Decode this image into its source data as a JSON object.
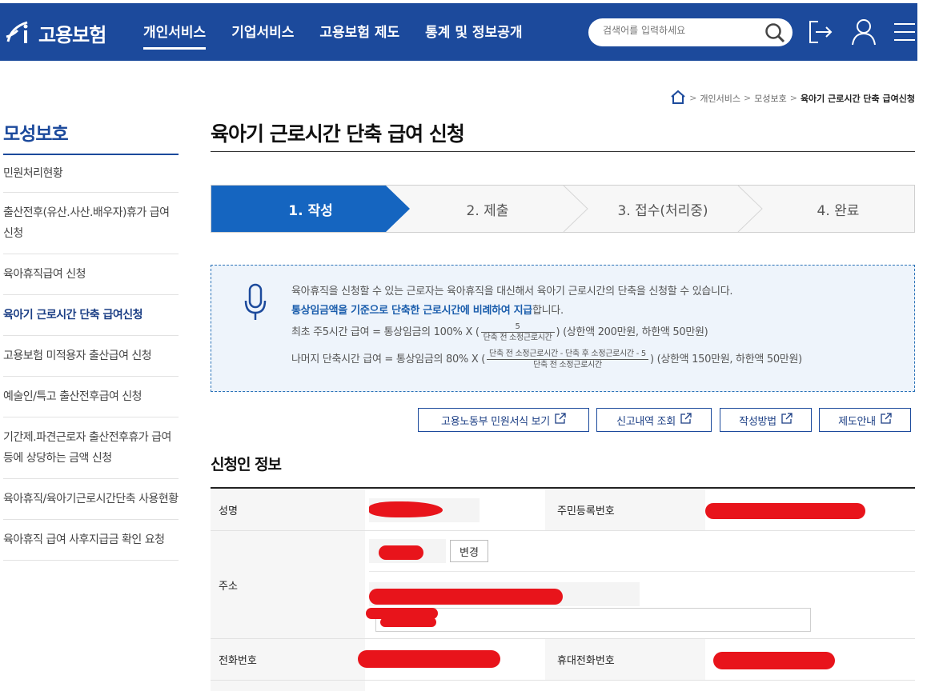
{
  "header": {
    "logo_text": "고용보험",
    "nav": [
      {
        "label": "개인서비스",
        "active": true
      },
      {
        "label": "기업서비스",
        "active": false
      },
      {
        "label": "고용보험 제도",
        "active": false
      },
      {
        "label": "통계 및 정보공개",
        "active": false
      }
    ],
    "search_placeholder": "검색어를 입력하세요",
    "accent": "#1c4a9c"
  },
  "breadcrumb": {
    "items": [
      "개인서비스",
      "모성보호"
    ],
    "current": "육아기 근로시간 단축 급여신청"
  },
  "sidebar": {
    "title": "모성보호",
    "items": [
      {
        "label": "민원처리현황",
        "active": false
      },
      {
        "label": "출산전후(유산.사산.배우자)휴가 급여신청",
        "active": false
      },
      {
        "label": "육아휴직급여 신청",
        "active": false
      },
      {
        "label": "육아기 근로시간 단축 급여신청",
        "active": true
      },
      {
        "label": "고용보험 미적용자 출산급여 신청",
        "active": false
      },
      {
        "label": "예술인/특고 출산전후급여 신청",
        "active": false
      },
      {
        "label": "기간제.파견근로자 출산전후휴가 급여등에 상당하는 금액 신청",
        "active": false
      },
      {
        "label": "육아휴직/육아기근로시간단축 사용현황",
        "active": false
      },
      {
        "label": "육아휴직 급여 사후지급금 확인 요청",
        "active": false
      }
    ]
  },
  "main": {
    "title": "육아기 근로시간 단축 급여 신청",
    "steps": [
      {
        "label": "1. 작성",
        "active": true
      },
      {
        "label": "2. 제출",
        "active": false
      },
      {
        "label": "3. 접수(처리중)",
        "active": false
      },
      {
        "label": "4. 완료",
        "active": false
      }
    ],
    "info": {
      "line1": "육아휴직을 신청할 수 있는 근로자는 육아휴직을 대신해서 육아기 근로시간의 단축을 신청할 수 있습니다.",
      "line2_bold": "통상임금액을 기준으로 단축한 근로시간에 비례하여 지급",
      "line2_rest": "합니다.",
      "line3_prefix": "최초 주5시간 급여 = 통상임금의 100% X (",
      "line3_num": "5",
      "line3_den": "단축 전 소정근로시간",
      "line3_suffix": ") (상한액 200만원, 하한액 50만원)",
      "line4_prefix": "나머지 단축시간 급여 = 통상임금의 80% X (",
      "line4_num": "단축 전 소정근로시간 - 단축 후 소정근로시간 - 5",
      "line4_den": "단축 전 소정근로시간",
      "line4_suffix": ") (상한액 150만원, 하한액 50만원)"
    },
    "buttons": [
      "고용노동부 민원서식 보기",
      "신고내역 조회",
      "작성방법",
      "제도안내"
    ],
    "section_title": "신청인 정보",
    "form": {
      "name_label": "성명",
      "rrn_label": "주민등록번호",
      "address_label": "주소",
      "change_button": "변경",
      "phone_label": "전화번호",
      "mobile_label": "휴대전화번호"
    }
  }
}
